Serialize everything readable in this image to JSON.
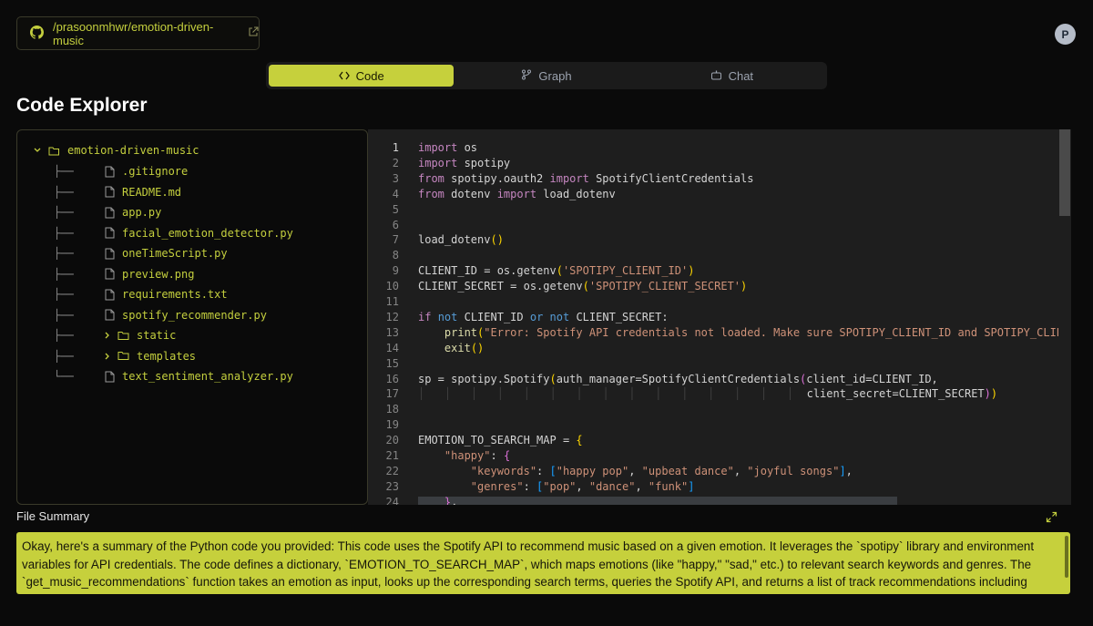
{
  "repo": {
    "path": "/prasoonmhwr/emotion-driven-music"
  },
  "user": {
    "avatar_initial": "P"
  },
  "tabs": [
    {
      "label": "Code",
      "icon": "code-icon",
      "active": true
    },
    {
      "label": "Graph",
      "icon": "graph-icon",
      "active": false
    },
    {
      "label": "Chat",
      "icon": "chat-icon",
      "active": false
    }
  ],
  "page": {
    "title": "Code Explorer"
  },
  "tree": {
    "root": "emotion-driven-music",
    "items": [
      {
        "branch": "├──",
        "name": ".gitignore",
        "type": "file"
      },
      {
        "branch": "├──",
        "name": "README.md",
        "type": "file"
      },
      {
        "branch": "├──",
        "name": "app.py",
        "type": "file"
      },
      {
        "branch": "├──",
        "name": "facial_emotion_detector.py",
        "type": "file"
      },
      {
        "branch": "├──",
        "name": "oneTimeScript.py",
        "type": "file"
      },
      {
        "branch": "├──",
        "name": "preview.png",
        "type": "file"
      },
      {
        "branch": "├──",
        "name": "requirements.txt",
        "type": "file"
      },
      {
        "branch": "├──",
        "name": "spotify_recommender.py",
        "type": "file"
      },
      {
        "branch": "├──",
        "name": "static",
        "type": "folder"
      },
      {
        "branch": "├──",
        "name": "templates",
        "type": "folder"
      },
      {
        "branch": "└──",
        "name": "text_sentiment_analyzer.py",
        "type": "file"
      }
    ]
  },
  "editor": {
    "current_line": 1,
    "line_numbers": [
      "1",
      "2",
      "3",
      "4",
      "5",
      "6",
      "7",
      "8",
      "9",
      "10",
      "11",
      "12",
      "13",
      "14",
      "15",
      "16",
      "17",
      "18",
      "19",
      "20",
      "21",
      "22",
      "23",
      "24"
    ]
  },
  "summary": {
    "label": "File Summary",
    "text": "Okay, here's a summary of the Python code you provided: This code uses the Spotify API to recommend music based on a given emotion. It leverages the `spotipy` library and environment variables for API credentials. The code defines a dictionary, `EMOTION_TO_SEARCH_MAP`, which maps emotions (like \"happy,\" \"sad,\" etc.) to relevant search keywords and genres. The `get_music_recommendations` function takes an emotion as input, looks up the corresponding search terms, queries the Spotify API, and returns a list of track recommendations including"
  },
  "colors": {
    "accent": "#c6d03c",
    "editor_bg": "#1e1e1e",
    "page_bg": "#0a0a0a"
  }
}
